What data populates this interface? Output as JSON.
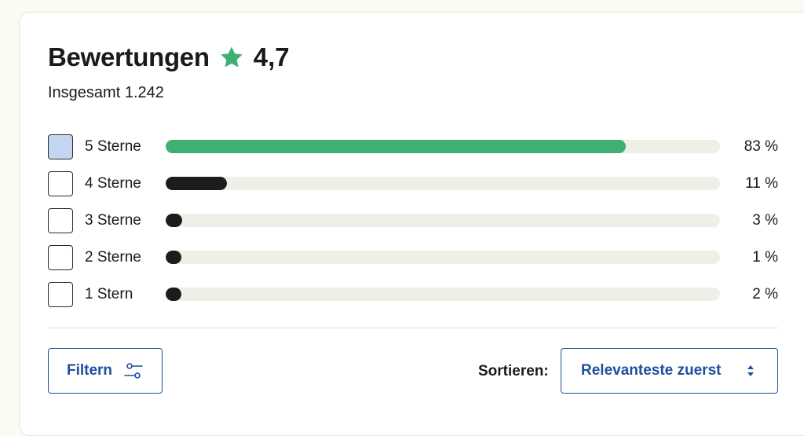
{
  "reviews": {
    "title": "Bewertungen",
    "rating": "4,7",
    "total": "Insgesamt 1.242",
    "accent_color": "#3fb072",
    "star_icon": "star-icon",
    "rows": [
      {
        "label": "5 Sterne",
        "percent_label": "83 %",
        "fraction": 0.83,
        "checked": true
      },
      {
        "label": "4 Sterne",
        "percent_label": "11 %",
        "fraction": 0.11,
        "checked": false
      },
      {
        "label": "3 Sterne",
        "percent_label": "3 %",
        "fraction": 0.03,
        "checked": false
      },
      {
        "label": "2 Sterne",
        "percent_label": "1 %",
        "fraction": 0.01,
        "checked": false
      },
      {
        "label": "1 Stern",
        "percent_label": "2 %",
        "fraction": 0.02,
        "checked": false
      }
    ]
  },
  "controls": {
    "filter_label": "Filtern",
    "filter_icon": "sliders-icon",
    "sort_label": "Sortieren:",
    "sort_value": "Relevanteste zuerst",
    "sort_icon": "sort-arrows-icon",
    "button_color": "#1f4fa0"
  }
}
